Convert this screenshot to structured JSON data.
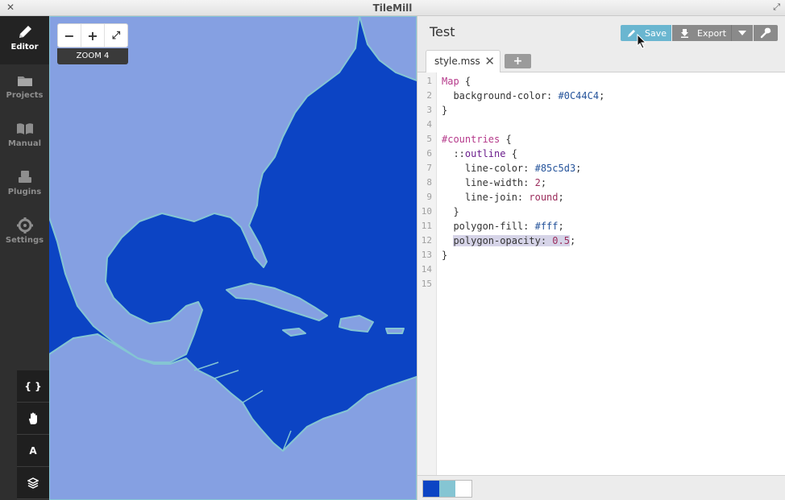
{
  "window": {
    "title": "TileMill"
  },
  "sidebar": {
    "items": [
      {
        "label": "Editor",
        "icon": "pencil-icon",
        "active": true
      },
      {
        "label": "Projects",
        "icon": "folder-icon",
        "active": false
      },
      {
        "label": "Manual",
        "icon": "book-icon",
        "active": false
      },
      {
        "label": "Plugins",
        "icon": "plugin-icon",
        "active": false
      },
      {
        "label": "Settings",
        "icon": "gear-icon",
        "active": false
      }
    ],
    "tools": [
      {
        "label": "{ }",
        "icon": "braces-icon"
      },
      {
        "label": "",
        "icon": "hand-icon"
      },
      {
        "label": "A",
        "icon": "font-icon"
      },
      {
        "label": "",
        "icon": "layers-icon"
      }
    ]
  },
  "map": {
    "zoom_out": "−",
    "zoom_in": "+",
    "fullscreen": "⤢",
    "zoom_label": "ZOOM 4",
    "water_color": "#0C44C4",
    "land_color": "#85a0e2",
    "outline_color": "#85c5d3"
  },
  "panel": {
    "project_title": "Test",
    "save_label": "Save",
    "export_label": "Export",
    "tab_label": "style.mss",
    "tab_close": "✕",
    "tab_add": "+",
    "line_numbers": [
      "1",
      "2",
      "3",
      "4",
      "5",
      "6",
      "7",
      "8",
      "9",
      "10",
      "11",
      "12",
      "13",
      "14",
      "15"
    ],
    "code": {
      "l1a": "Map",
      "l1b": " {",
      "l2a": "  background-color: ",
      "l2b": "#0C44C4",
      "l2c": ";",
      "l3": "}",
      "l5a": "#countries",
      "l5b": " {",
      "l6a": "  ::",
      "l6b": "outline",
      "l6c": " {",
      "l7a": "    line-color: ",
      "l7b": "#85c5d3",
      "l7c": ";",
      "l8a": "    line-width: ",
      "l8b": "2",
      "l8c": ";",
      "l9a": "    line-join: ",
      "l9b": "round",
      "l9c": ";",
      "l10": "  }",
      "l11a": "  polygon-fill: ",
      "l11b": "#fff",
      "l11c": ";",
      "l12a": "polygon-opacity: ",
      "l12b": "0.5",
      "l12c": ";",
      "l13": "}"
    },
    "swatches": [
      "#0C44C4",
      "#85c5d3",
      "#ffffff"
    ]
  }
}
